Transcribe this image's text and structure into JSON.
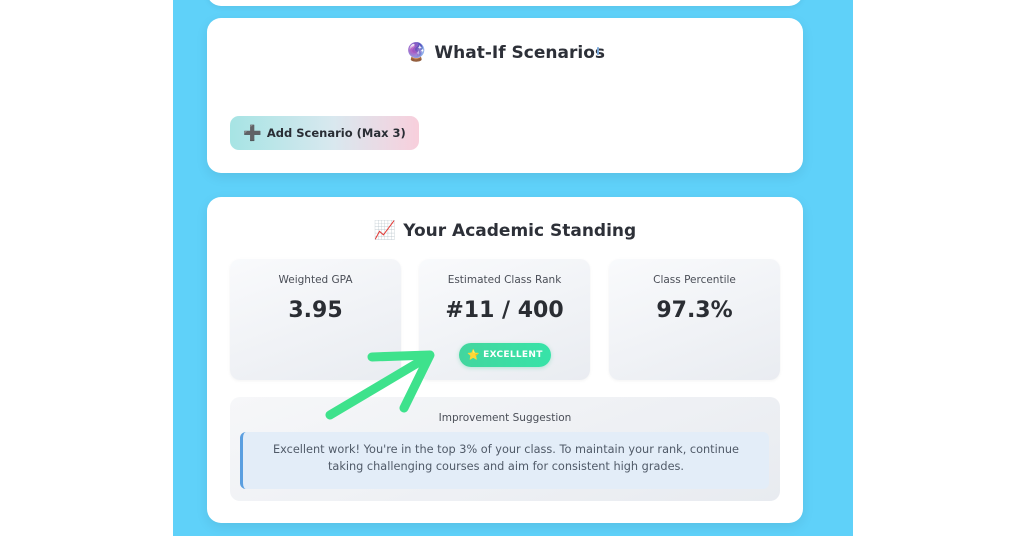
{
  "whatif": {
    "emoji": "🔮",
    "title": "What-If Scenarios",
    "add_button": "Add Scenario (Max 3)",
    "add_icon": "➕"
  },
  "standing": {
    "emoji": "📈",
    "title": "Your Academic Standing",
    "stats": [
      {
        "label": "Weighted GPA",
        "value": "3.95"
      },
      {
        "label": "Estimated Class Rank",
        "value": "#11 / 400",
        "badge": "EXCELLENT",
        "badge_icon": "⭐"
      },
      {
        "label": "Class Percentile",
        "value": "97.3%"
      }
    ],
    "suggestion": {
      "title": "Improvement Suggestion",
      "text": "Excellent work! You're in the top 3% of your class. To maintain your rank, continue taking challenging courses and aim for consistent high grades."
    }
  },
  "colors": {
    "background": "#5fd1f9",
    "badge": "#37e3a8",
    "annotation_arrow": "#3ee28c"
  }
}
